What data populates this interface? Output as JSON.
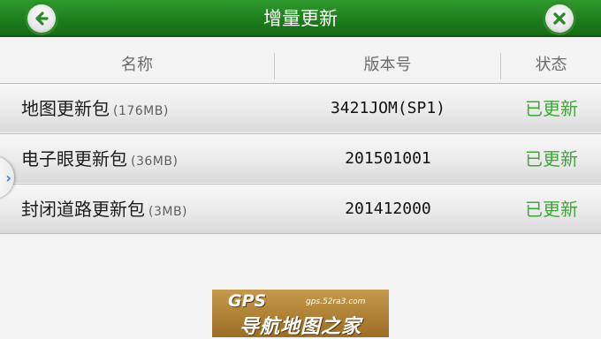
{
  "window": {
    "title": "增量更新"
  },
  "table": {
    "columns": {
      "name": "名称",
      "version": "版本号",
      "status": "状态"
    },
    "rows": [
      {
        "name": "地图更新包",
        "size": "(176MB)",
        "version": "3421JOM(SP1)",
        "status": "已更新"
      },
      {
        "name": "电子眼更新包",
        "size": "(36MB)",
        "version": "201501001",
        "status": "已更新"
      },
      {
        "name": "封闭道路更新包",
        "size": "(3MB)",
        "version": "201412000",
        "status": "已更新"
      }
    ]
  },
  "side_tab": {
    "glyph": "›"
  },
  "watermark": {
    "logo": "GPS",
    "url": "gps.52ra3.com",
    "text": "导航地图之家"
  },
  "colors": {
    "titlebar": "#1d7c1b",
    "status_text": "#3fa738",
    "side_arrow": "#3b7fc9"
  },
  "icons": {
    "back": "back-arrow-icon",
    "close": "close-icon"
  }
}
